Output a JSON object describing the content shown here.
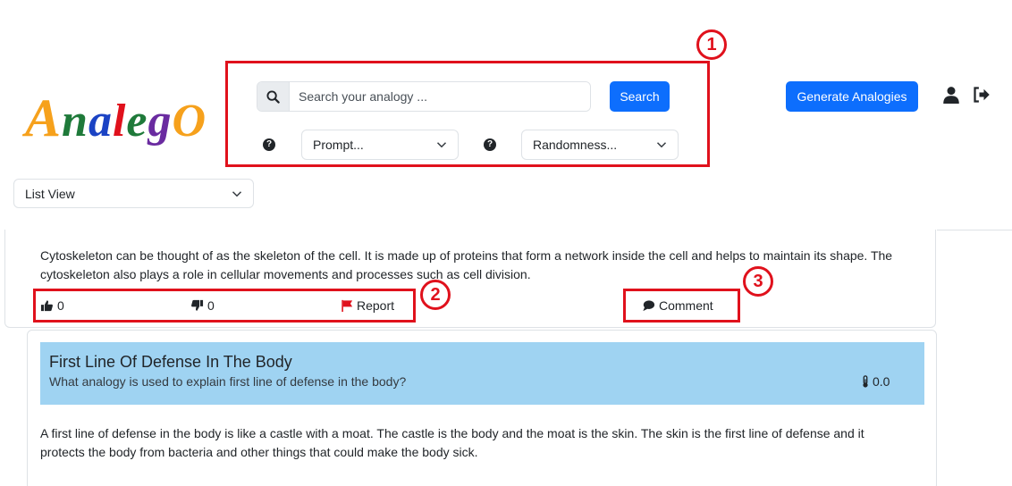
{
  "logo": {
    "letters": [
      {
        "char": "A",
        "color": "#f6a11c"
      },
      {
        "char": "n",
        "color": "#1f7a3a"
      },
      {
        "char": "a",
        "color": "#1b43c4"
      },
      {
        "char": "l",
        "color": "#e0111c"
      },
      {
        "char": "e",
        "color": "#1f7a3a"
      },
      {
        "char": "g",
        "color": "#6a2ba0"
      },
      {
        "char": "O",
        "color": "#f6a11c"
      }
    ]
  },
  "annotations": {
    "one": "1",
    "two": "2",
    "three": "3"
  },
  "search": {
    "placeholder": "Search your analogy ...",
    "value": "",
    "button_label": "Search"
  },
  "filters": {
    "prompt": "Prompt...",
    "randomness": "Randomness..."
  },
  "header": {
    "generate_label": "Generate Analogies"
  },
  "view_select": {
    "value": "List View"
  },
  "cards": [
    {
      "text": "Cytoskeleton can be thought of as the skeleton of the cell. It is made up of proteins that form a network inside the cell and helps to maintain its shape. The cytoskeleton also plays a role in cellular movements and processes such as cell division.",
      "likes": "0",
      "dislikes": "0",
      "report_label": "Report",
      "comment_label": "Comment"
    },
    {
      "title": "First Line Of Defense In The Body",
      "question": "What analogy is used to explain first line of defense in the body?",
      "temperature": "0.0",
      "text": "A first line of defense in the body is like a castle with a moat. The castle is the body and the moat is the skin. The skin is the first line of defense and it protects the body from bacteria and other things that could make the body sick."
    }
  ],
  "colors": {
    "primary": "#0d6efd",
    "annotation_red": "#e0111c",
    "header_band": "#9fd3f2",
    "report_flag": "#e0111c"
  },
  "icons": [
    "search-icon",
    "question-icon",
    "chevron-down-icon",
    "user-icon",
    "logout-icon",
    "thumbs-up-icon",
    "thumbs-down-icon",
    "flag-icon",
    "comment-icon",
    "thermometer-icon"
  ]
}
